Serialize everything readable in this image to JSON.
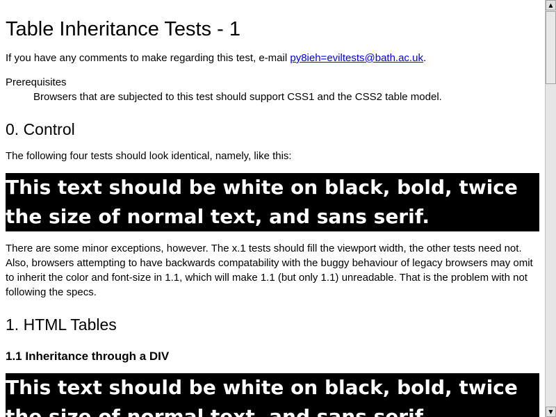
{
  "page": {
    "title": "Table Inheritance Tests - 1",
    "intro_text": "If you have any comments to make regarding this test, e-mail ",
    "intro_link": "py8ieh=eviltests@bath.ac.uk",
    "intro_end": ".",
    "prereq_term": "Prerequisites",
    "prereq_desc": "Browsers that are subjected to this test should support CSS1 and the CSS2 table model.",
    "control_heading": "0. Control",
    "control_text": "The following four tests should look identical, namely, like this:",
    "sample_text": "This text should be white on black, bold, twice the size of normal text, and sans serif.",
    "exceptions_text": "There are some minor exceptions, however. The x.1 tests should fill the viewport width, the other tests need not. Also, browsers attempting to have backwards compatability with the buggy behaviour of legacy browsers may omit to inherit the color and font-size in 1.1, which will make 1.1 (but only 1.1) unreadable. That is the problem with not following the specs.",
    "html_tables_heading": "1. HTML Tables",
    "div_heading": "1.1 Inheritance through a DIV",
    "sample_text_2": "This text should be white on black, bold, twice the size of normal text, and sans serif."
  },
  "scrollbar": {
    "up_arrow": "▲",
    "down_arrow": "▼"
  },
  "colors": {
    "link": "#0000ee",
    "sample_bg": "#000000",
    "sample_fg": "#ffffff"
  }
}
